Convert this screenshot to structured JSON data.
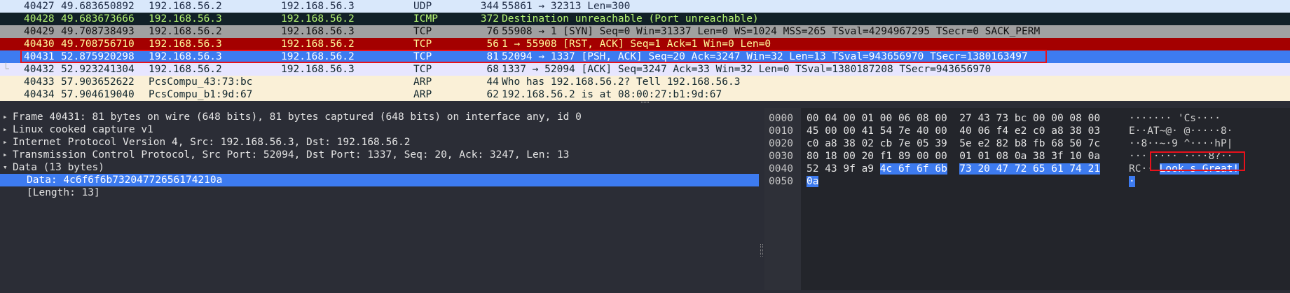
{
  "packets": [
    {
      "no": "40427",
      "time": "49.683650892",
      "src": "192.168.56.2",
      "dst": "192.168.56.3",
      "proto": "UDP",
      "len": "344",
      "info": "55861 → 32313 Len=300",
      "bg": "#d9e8fb",
      "fg": "#1d2a44"
    },
    {
      "no": "40428",
      "time": "49.683673666",
      "src": "192.168.56.3",
      "dst": "192.168.56.2",
      "proto": "ICMP",
      "len": "372",
      "info": "Destination unreachable (Port unreachable)",
      "bg": "#112027",
      "fg": "#b7f774"
    },
    {
      "no": "40429",
      "time": "49.708738493",
      "src": "192.168.56.2",
      "dst": "192.168.56.3",
      "proto": "TCP",
      "len": "76",
      "info": "55908 → 1 [SYN] Seq=0 Win=31337 Len=0 WS=1024 MSS=265 TSval=4294967295 TSecr=0 SACK_PERM",
      "bg": "#a0a0a0",
      "fg": "#111111"
    },
    {
      "no": "40430",
      "time": "49.708756710",
      "src": "192.168.56.3",
      "dst": "192.168.56.2",
      "proto": "TCP",
      "len": "56",
      "info": "1 → 55908 [RST, ACK] Seq=1 Ack=1 Win=0 Len=0",
      "bg": "#a40000",
      "fg": "#fffc9c"
    },
    {
      "no": "40431",
      "time": "52.875920298",
      "src": "192.168.56.3",
      "dst": "192.168.56.2",
      "proto": "TCP",
      "len": "81",
      "info": "52094 → 1337 [PSH, ACK] Seq=20 Ack=3247 Win=32 Len=13 TSval=943656970 TSecr=1380163497",
      "bg": "#3d7bf0",
      "fg": "#ffffff"
    },
    {
      "no": "40432",
      "time": "52.923241304",
      "src": "192.168.56.2",
      "dst": "192.168.56.3",
      "proto": "TCP",
      "len": "68",
      "info": "1337 → 52094 [ACK] Seq=3247 Ack=33 Win=32 Len=0 TSval=1380187208 TSecr=943656970",
      "bg": "#e7e6ff",
      "fg": "#12272e"
    },
    {
      "no": "40433",
      "time": "57.903652622",
      "src": "PcsCompu_43:73:bc",
      "dst": "",
      "proto": "ARP",
      "len": "44",
      "info": "Who has 192.168.56.2? Tell 192.168.56.3",
      "bg": "#faf0d7",
      "fg": "#12272e"
    },
    {
      "no": "40434",
      "time": "57.904619040",
      "src": "PcsCompu_b1:9d:67",
      "dst": "",
      "proto": "ARP",
      "len": "62",
      "info": "192.168.56.2 is at 08:00:27:b1:9d:67",
      "bg": "#faf0d7",
      "fg": "#12272e"
    }
  ],
  "details": [
    {
      "text": "Frame 40431: 81 bytes on wire (648 bits), 81 bytes captured (648 bits) on interface any, id 0",
      "tri": "▸",
      "child": false,
      "sel": false
    },
    {
      "text": "Linux cooked capture v1",
      "tri": "▸",
      "child": false,
      "sel": false
    },
    {
      "text": "Internet Protocol Version 4, Src: 192.168.56.3, Dst: 192.168.56.2",
      "tri": "▸",
      "child": false,
      "sel": false
    },
    {
      "text": "Transmission Control Protocol, Src Port: 52094, Dst Port: 1337, Seq: 20, Ack: 3247, Len: 13",
      "tri": "▸",
      "child": false,
      "sel": false
    },
    {
      "text": "Data (13 bytes)",
      "tri": "▾",
      "child": false,
      "sel": false
    },
    {
      "text": "Data: 4c6f6f6b73204772656174210a",
      "tri": "",
      "child": true,
      "sel": true
    },
    {
      "text": "[Length: 13]",
      "tri": "",
      "child": true,
      "sel": false
    }
  ],
  "bytes": [
    {
      "off": "0000",
      "hex1": "00 04 00 01 00 06 08 00",
      "hex2": "27 43 73 bc 00 00 08 00",
      "hl1": "",
      "hl2": "",
      "ascii": "······· 'Cs····",
      "asciiHl": ""
    },
    {
      "off": "0010",
      "hex1": "45 00 00 41 54 7e 40 00",
      "hex2": "40 06 f4 e2 c0 a8 38 03",
      "hl1": "",
      "hl2": "",
      "ascii": "E··AT~@· @·····8·",
      "asciiHl": ""
    },
    {
      "off": "0020",
      "hex1": "c0 a8 38 02 cb 7e 05 39",
      "hex2": "5e e2 82 b8 fb 68 50 7c",
      "hl1": "",
      "hl2": "",
      "ascii": "··8··~·9 ^····hP|",
      "asciiHl": ""
    },
    {
      "off": "0030",
      "hex1": "80 18 00 20 f1 89 00 00",
      "hex2": "01 01 08 0a 38 3f 10 0a",
      "hl1": "",
      "hl2": "",
      "ascii": "··· ···· ····8?··",
      "asciiHl": ""
    },
    {
      "off": "0040",
      "hex1": "52 43 9f a9",
      "hex2": "",
      "hl1": "4c 6f 6f 6b",
      "hl2": "73 20 47 72 65 61 74 21",
      "ascii": "RC··",
      "asciiHl": "Look s Great!"
    },
    {
      "off": "0050",
      "hex1": "",
      "hex2": "",
      "hl1": "0a",
      "hl2": "",
      "ascii": "",
      "asciiHl": "·"
    }
  ],
  "ui": {
    "splitter_grip": "⋯⋯"
  }
}
